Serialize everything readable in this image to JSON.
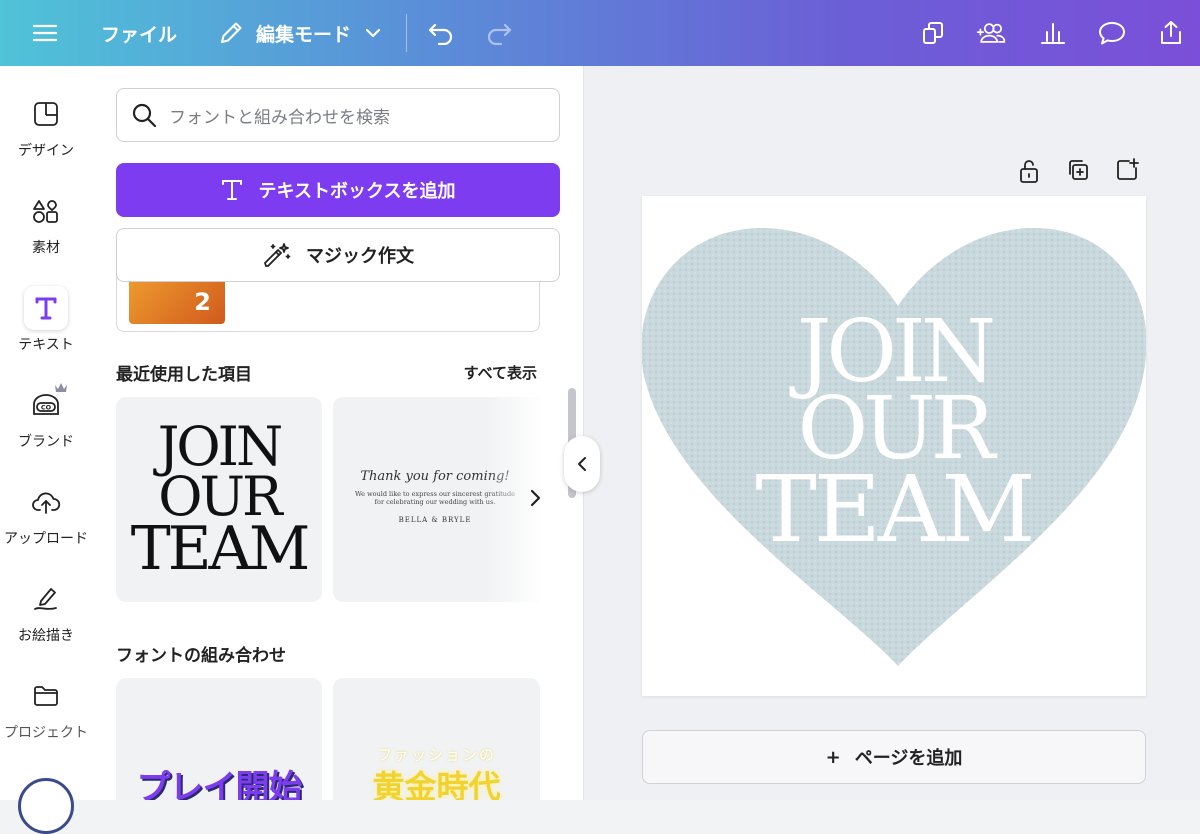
{
  "topbar": {
    "file_label": "ファイル",
    "edit_mode_label": "編集モード"
  },
  "rail": {
    "items": [
      {
        "label": "デザイン",
        "icon": "layout-icon"
      },
      {
        "label": "素材",
        "icon": "shapes-icon"
      },
      {
        "label": "テキスト",
        "icon": "text-icon",
        "active": true
      },
      {
        "label": "ブランド",
        "icon": "brand-icon"
      },
      {
        "label": "アップロード",
        "icon": "upload-cloud-icon"
      },
      {
        "label": "お絵描き",
        "icon": "pen-icon"
      },
      {
        "label": "プロジェクト",
        "icon": "folder-icon"
      }
    ]
  },
  "panel": {
    "search_placeholder": "フォントと組み合わせを検索",
    "add_textbox_label": "テキストボックスを追加",
    "magic_write_label": "マジック作文",
    "peek_number": "2",
    "recent_title": "最近使用した項目",
    "see_all_label": "すべて表示",
    "recent": [
      {
        "lines": [
          "JOIN",
          "OUR",
          "TEAM"
        ]
      },
      {
        "script": "Thank you for coming!",
        "body": "We would like to express our sincerest gratitude for celebrating our wedding with us.",
        "names": "BELLA & BRYLE"
      }
    ],
    "combos_title": "フォントの組み合わせ",
    "combos": [
      {
        "text": "プレイ開始"
      },
      {
        "small": "ファッションの",
        "text": "黄金時代"
      }
    ]
  },
  "canvas": {
    "heart_text": [
      "JOIN",
      "OUR",
      "TEAM"
    ],
    "add_page_label": "ページを追加",
    "add_page_icon": "+"
  },
  "colors": {
    "accent": "#7d3cf0",
    "heart": "#c9d9de"
  }
}
